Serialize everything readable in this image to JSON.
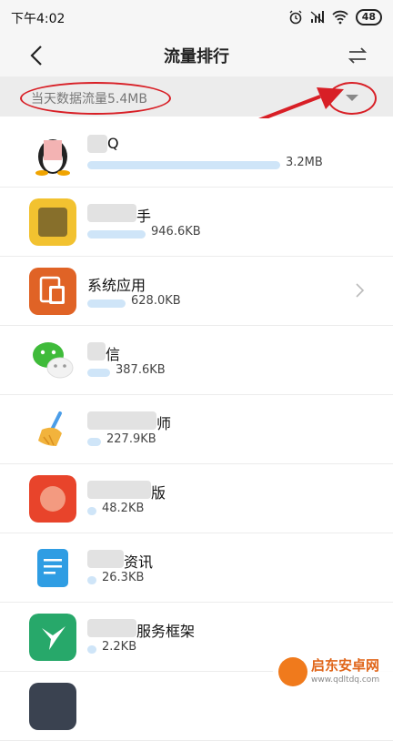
{
  "status_bar": {
    "time": "下午4:02",
    "battery": "48"
  },
  "header": {
    "title": "流量排行"
  },
  "summary": {
    "text": "当天数据流量5.4MB"
  },
  "apps": [
    {
      "name": "Q",
      "size": "3.2MB",
      "bar_fraction": 1.0
    },
    {
      "name": "手",
      "size": "946.6KB",
      "bar_fraction": 0.3
    },
    {
      "name": "系统应用",
      "size": "628.0KB",
      "bar_fraction": 0.2
    },
    {
      "name": "信",
      "size": "387.6KB",
      "bar_fraction": 0.12
    },
    {
      "name": "师",
      "size": "227.9KB",
      "bar_fraction": 0.07
    },
    {
      "name": "版",
      "size": "48.2KB",
      "bar_fraction": 0.015
    },
    {
      "name": "资讯",
      "size": "26.3KB",
      "bar_fraction": 0.008
    },
    {
      "name": "服务框架",
      "size": "2.2KB",
      "bar_fraction": 0.001
    }
  ],
  "watermark": {
    "title": "启东安卓网",
    "url": "www.qdltdq.com"
  },
  "colors": {
    "bar": "#cfe5f8",
    "annotation": "#d81f26"
  }
}
